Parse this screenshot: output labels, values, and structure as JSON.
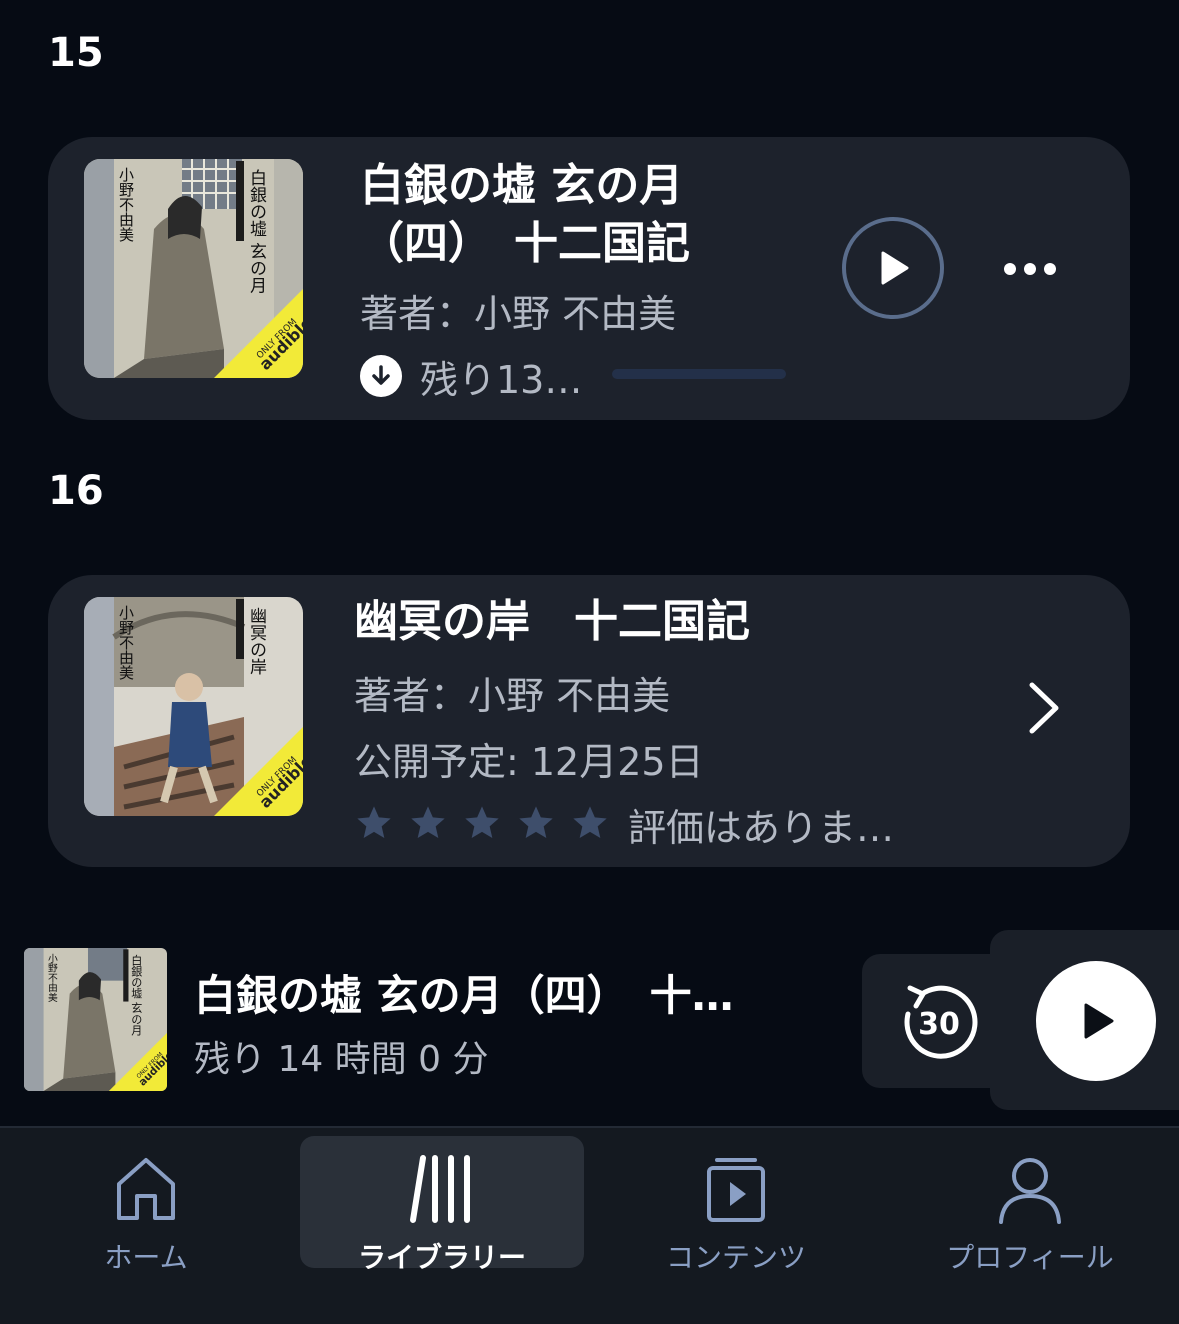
{
  "colors": {
    "background": "#060b14",
    "card": "#1d222c",
    "accent_inactive": "#8a9fc4",
    "star": "#3e4e6b",
    "play_ring": "#5a6d8c"
  },
  "items": [
    {
      "rank": "15",
      "title_line1": "白銀の墟 玄の月",
      "title_line2": "（四）　十二国記",
      "author": "著者：小野 不由美",
      "remaining": "残り13…",
      "progress": 0.0,
      "cover_text": "白銀の墟 玄の月",
      "cover_author": "小野不由美",
      "badge_top": "ONLY FROM",
      "badge_bottom": "audible",
      "icons": [
        "play-icon",
        "more-icon",
        "download-icon"
      ]
    },
    {
      "rank": "16",
      "title": "幽冥の岸　十二国記",
      "author": "著者：小野 不由美",
      "release": "公開予定: 12月25日",
      "rating_text": "評価はありま…",
      "rating": 0,
      "cover_text": "幽冥の岸",
      "cover_author": "小野不由美",
      "badge_top": "ONLY FROM",
      "badge_bottom": "audible",
      "icons": [
        "star-icon",
        "chevron-right-icon"
      ]
    }
  ],
  "mini_player": {
    "title": "白銀の墟 玄の月（四）　十…",
    "remaining": "残り 14 時間 0 分",
    "skip_back_seconds": "30",
    "cover_text": "白銀の墟 玄の月",
    "cover_author": "小野不由美",
    "badge_top": "ONLY FROM",
    "badge_bottom": "audible"
  },
  "tabs": [
    {
      "label": "ホーム",
      "icon": "home-icon",
      "active": false
    },
    {
      "label": "ライブラリー",
      "icon": "library-icon",
      "active": true
    },
    {
      "label": "コンテンツ",
      "icon": "content-icon",
      "active": false
    },
    {
      "label": "プロフィール",
      "icon": "profile-icon",
      "active": false
    }
  ]
}
